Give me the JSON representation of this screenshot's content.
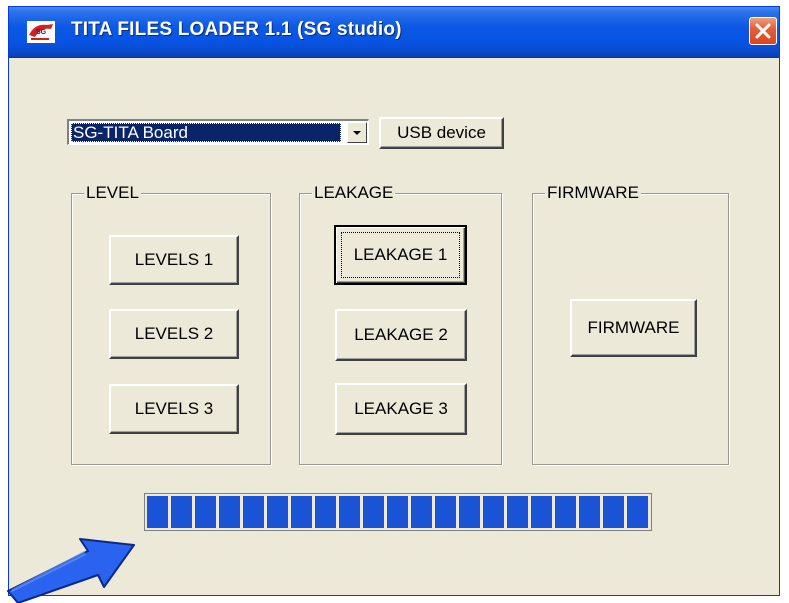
{
  "window": {
    "title": "TITA FILES LOADER 1.1 (SG studio)"
  },
  "device_select": {
    "value": "SG-TITA Board"
  },
  "usb_button": {
    "label": "USB device"
  },
  "groups": {
    "level": {
      "title": "LEVEL",
      "buttons": [
        "LEVELS 1",
        "LEVELS 2",
        "LEVELS 3"
      ]
    },
    "leakage": {
      "title": "LEAKAGE",
      "buttons": [
        "LEAKAGE 1",
        "LEAKAGE 2",
        "LEAKAGE 3"
      ]
    },
    "firmware": {
      "title": "FIRMWARE",
      "buttons": [
        "FIRMWARE"
      ]
    }
  },
  "progress": {
    "fraction": 1.0
  },
  "icons": {
    "app": "app-logo-icon",
    "close": "close-icon",
    "dropdown": "chevron-down-icon",
    "annotation": "arrow-annotation-icon"
  },
  "colors": {
    "titlebar": "#0754e3",
    "close_button": "#e4603a",
    "selection": "#0a246a",
    "progress_fill": "#1a53d6",
    "arrow_annotation": "#2a63f0"
  }
}
